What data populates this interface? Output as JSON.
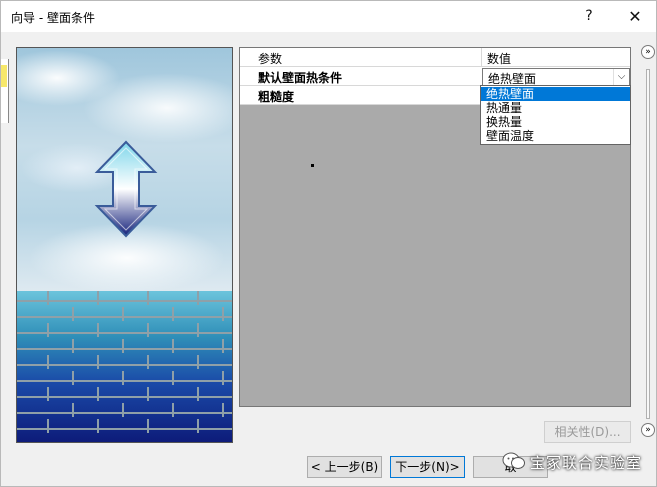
{
  "window": {
    "title": "向导 - 壁面条件",
    "help_glyph": "?",
    "close_glyph": "✕"
  },
  "grid": {
    "header": {
      "param": "参数",
      "value": "数值"
    },
    "rows": [
      {
        "param": "默认壁面热条件",
        "value": "绝热壁面"
      },
      {
        "param": "粗糙度",
        "value": ""
      }
    ],
    "dropdown_options": [
      "绝热壁面",
      "热通量",
      "换热量",
      "壁面温度"
    ],
    "selected_option": "绝热壁面"
  },
  "side_buttons": {
    "collapse_top": "»",
    "collapse_bottom": "»"
  },
  "buttons": {
    "correlation": "相关性(D)...",
    "back": "< 上一步(B)",
    "next": "下一步(N)>",
    "cancel": "取"
  },
  "watermark": {
    "text": "宝冢联合实验室"
  },
  "icons": {
    "arrow": "vertical-double-arrow-icon",
    "dropdown": "chevron-down-icon",
    "collapse": "double-chevron-right-icon"
  }
}
